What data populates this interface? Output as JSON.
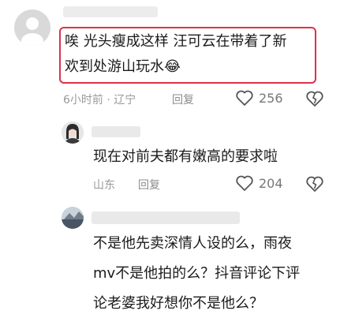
{
  "comments": [
    {
      "text_line1": "唉 光头瘦成这样 汪可云在带着了新",
      "text_line2": "欢到处游山玩水",
      "emoji": "😂",
      "time": "6小时前",
      "separator": "·",
      "location": "辽宁",
      "reply_label": "回复",
      "likes": "256"
    },
    {
      "text": "现在对前夫都有嫩高的要求啦",
      "location": "山东",
      "reply_label": "回复",
      "likes": "204"
    },
    {
      "text_line1": "不是他先卖深情人设的么，雨夜",
      "text_line2": "mv不是他拍的么？抖音评论下评",
      "text_line3": "论老婆我好想你不是他么？"
    }
  ],
  "colors": {
    "highlight_border": "#e0304a",
    "meta_text": "#9a9a9a",
    "body_text": "#1b1b1b"
  },
  "icons": [
    "default-avatar-icon",
    "heart-outline-icon",
    "broken-heart-icon"
  ]
}
